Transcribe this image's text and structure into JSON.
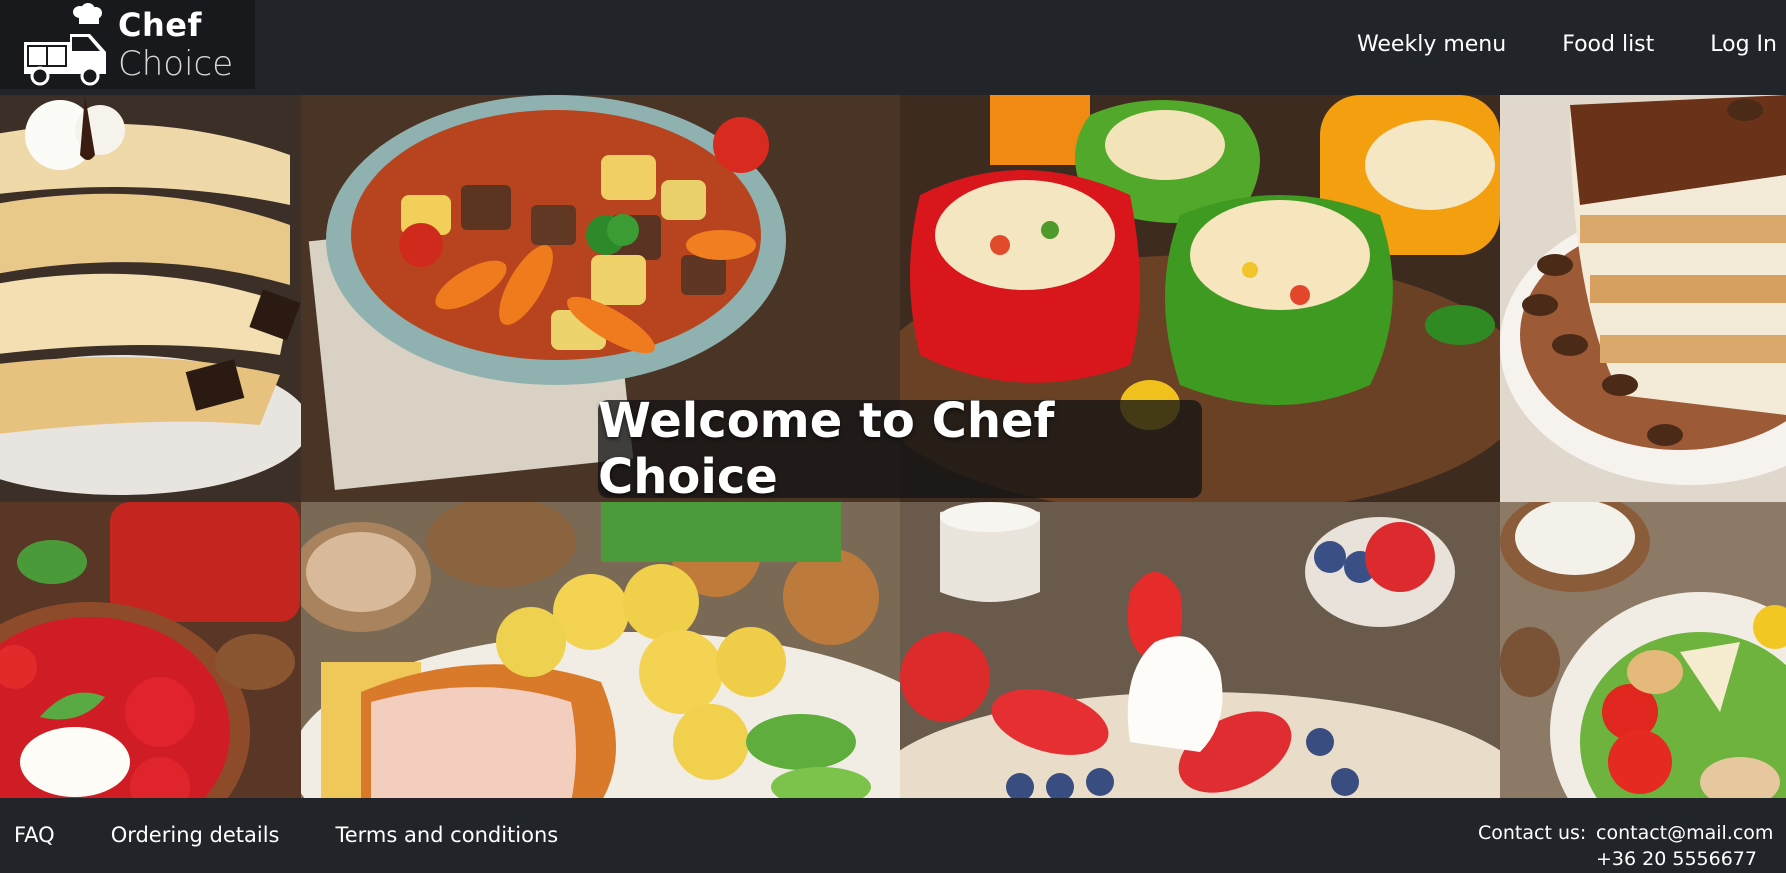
{
  "brand": {
    "line1": "Chef",
    "line2": "Choice",
    "logo_icon": "chef-van-icon"
  },
  "nav": {
    "items": [
      "Weekly menu",
      "Food list",
      "Log In"
    ]
  },
  "hero": {
    "title": "Welcome to Chef Choice"
  },
  "gallery": {
    "tiles": [
      "crepes-image",
      "beef-stew-image",
      "stuffed-peppers-image",
      "tiramisu-image",
      "strawberry-soup-image",
      "schnitzel-potatoes-image",
      "strawberry-crepes-image",
      "caesar-salad-image"
    ]
  },
  "footer": {
    "links": [
      "FAQ",
      "Ordering details",
      "Terms and conditions"
    ],
    "contact_label": "Contact us:",
    "email": "contact@mail.com",
    "phone": "+36 20 5556677"
  },
  "colors": {
    "background": "#212529",
    "brand_box": "#18191c",
    "text": "#ffffff"
  }
}
